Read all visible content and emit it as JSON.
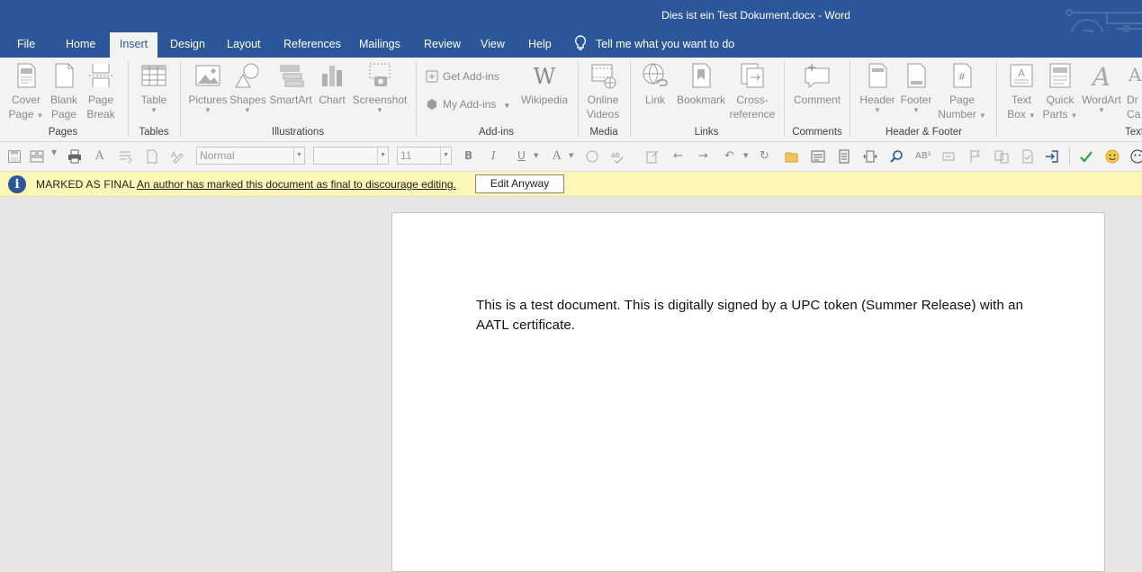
{
  "window": {
    "title": "Dies ist ein Test Dokument.docx  -  Word"
  },
  "tabs": [
    {
      "label": "File"
    },
    {
      "label": "Home"
    },
    {
      "label": "Insert",
      "active": true
    },
    {
      "label": "Design"
    },
    {
      "label": "Layout"
    },
    {
      "label": "References"
    },
    {
      "label": "Mailings"
    },
    {
      "label": "Review"
    },
    {
      "label": "View"
    },
    {
      "label": "Help"
    }
  ],
  "tell_me": "Tell me what you want to do",
  "ribbon": {
    "groups": {
      "pages": "Pages",
      "tables": "Tables",
      "illustrations": "Illustrations",
      "addins": "Add-ins",
      "media": "Media",
      "links": "Links",
      "comments": "Comments",
      "header_footer": "Header & Footer",
      "text": "Text"
    },
    "buttons": {
      "cover_page": [
        "Cover",
        "Page"
      ],
      "blank_page": [
        "Blank",
        "Page"
      ],
      "page_break": [
        "Page",
        "Break"
      ],
      "table": "Table",
      "pictures": "Pictures",
      "shapes": "Shapes",
      "smartart": "SmartArt",
      "chart": "Chart",
      "screenshot": "Screenshot",
      "get_addins": "Get Add-ins",
      "my_addins": "My Add-ins",
      "wikipedia": "Wikipedia",
      "online_videos": [
        "Online",
        "Videos"
      ],
      "link": "Link",
      "bookmark": "Bookmark",
      "cross_reference": [
        "Cross-",
        "reference"
      ],
      "comment": "Comment",
      "header": "Header",
      "footer": "Footer",
      "page_number": [
        "Page",
        "Number"
      ],
      "text_box": [
        "Text",
        "Box"
      ],
      "quick_parts": [
        "Quick",
        "Parts"
      ],
      "wordart": "WordArt",
      "drop_cap": [
        "Dr",
        "Ca"
      ]
    }
  },
  "toolbar": {
    "style_value": "Normal",
    "font_value": "",
    "size_value": "11"
  },
  "message_bar": {
    "title": "MARKED AS FINAL",
    "text": "An author has marked this document as final to discourage editing.",
    "button": "Edit Anyway"
  },
  "document": {
    "body": "This is a test document. This is digitally signed by a UPC token (Summer Release) with an AATL certificate."
  },
  "colors": {
    "accent": "#2b579a",
    "message_bar": "#fcf7b6",
    "ribbon": "#f3f3f3"
  }
}
